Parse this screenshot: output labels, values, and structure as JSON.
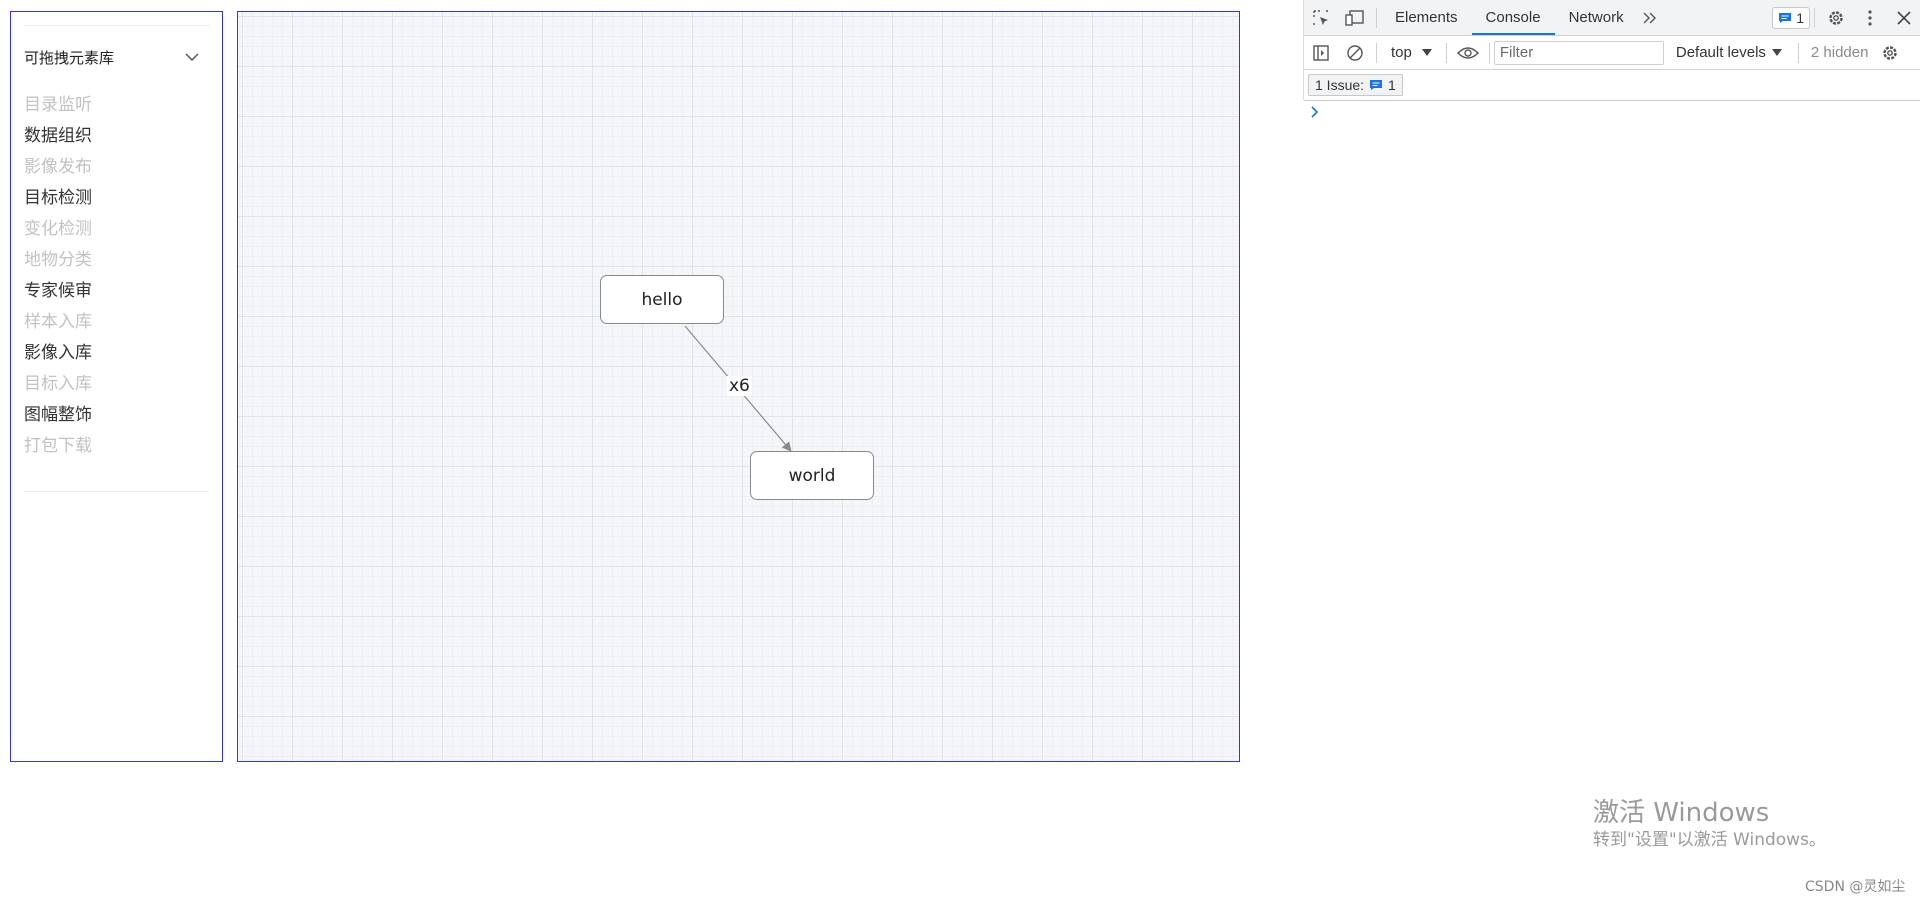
{
  "sidebar": {
    "collapse_title": "可拖拽元素库",
    "items": [
      {
        "label": "目录监听",
        "disabled": true
      },
      {
        "label": "数据组织",
        "disabled": false
      },
      {
        "label": "影像发布",
        "disabled": true
      },
      {
        "label": "目标检测",
        "disabled": false
      },
      {
        "label": "变化检测",
        "disabled": true
      },
      {
        "label": "地物分类",
        "disabled": true
      },
      {
        "label": "专家候审",
        "disabled": false
      },
      {
        "label": "样本入库",
        "disabled": true
      },
      {
        "label": "影像入库",
        "disabled": false
      },
      {
        "label": "目标入库",
        "disabled": true
      },
      {
        "label": "图幅整饰",
        "disabled": false
      },
      {
        "label": "打包下载",
        "disabled": true
      }
    ]
  },
  "canvas": {
    "nodes": [
      {
        "id": "hello",
        "label": "hello"
      },
      {
        "id": "world",
        "label": "world"
      }
    ],
    "edge": {
      "source": "hello",
      "target": "world",
      "label": "x6",
      "color": "#8a8a8a"
    },
    "grid_color": "#e1e5ea"
  },
  "devtools": {
    "tabs": [
      "Elements",
      "Console",
      "Network"
    ],
    "active_tab": "Console",
    "issues_badge": "1",
    "context": "top",
    "filter_placeholder": "Filter",
    "levels_label": "Default levels",
    "hidden_label": "2 hidden",
    "issues_label": "1 Issue:",
    "issues_count": "1",
    "accent_color": "#1a73e8"
  },
  "watermark": {
    "line1": "激活 Windows",
    "line2": "转到\"设置\"以激活 Windows。",
    "credit": "CSDN @灵如尘"
  }
}
